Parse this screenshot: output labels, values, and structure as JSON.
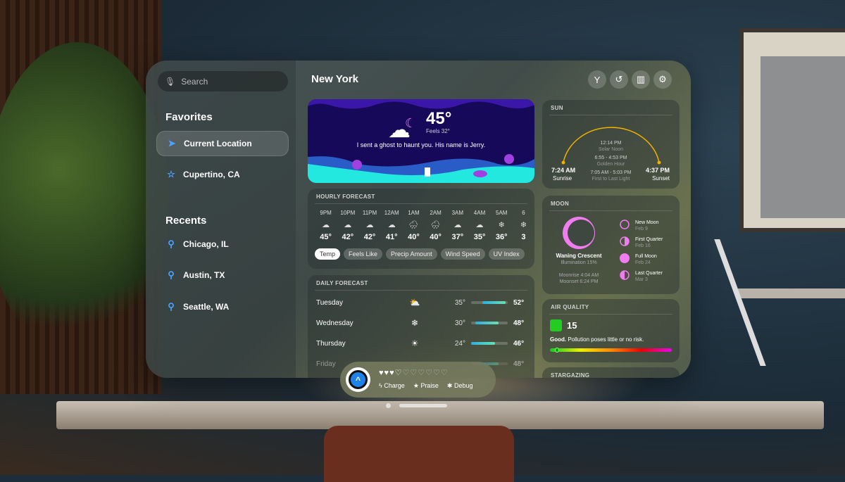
{
  "sidebar": {
    "search_placeholder": "Search",
    "favorites_heading": "Favorites",
    "favorites": [
      {
        "label": "Current Location",
        "icon": "location-arrow-icon",
        "selected": true
      },
      {
        "label": "Cupertino, CA",
        "icon": "star-icon"
      }
    ],
    "recents_heading": "Recents",
    "recents": [
      {
        "label": "Chicago, IL",
        "icon": "pin-icon"
      },
      {
        "label": "Austin, TX",
        "icon": "pin-icon"
      },
      {
        "label": "Seattle, WA",
        "icon": "pin-icon"
      }
    ]
  },
  "header": {
    "title": "New York",
    "buttons": [
      "split-icon",
      "history-icon",
      "map-icon",
      "gear-icon"
    ]
  },
  "hero": {
    "temp": "45°",
    "feels": "Feels 32°",
    "quip": "I sent a ghost to haunt you. His name is Jerry."
  },
  "hourly": {
    "heading": "HOURLY FORECAST",
    "hours": [
      {
        "t": "9PM",
        "i": "☁",
        "v": "45°"
      },
      {
        "t": "10PM",
        "i": "☁",
        "v": "42°"
      },
      {
        "t": "11PM",
        "i": "☁",
        "v": "42°"
      },
      {
        "t": "12AM",
        "i": "☁",
        "v": "41°"
      },
      {
        "t": "1AM",
        "i": "🌧",
        "v": "40°"
      },
      {
        "t": "2AM",
        "i": "🌧",
        "v": "40°"
      },
      {
        "t": "3AM",
        "i": "☁",
        "v": "37°"
      },
      {
        "t": "4AM",
        "i": "☁",
        "v": "35°"
      },
      {
        "t": "5AM",
        "i": "❄",
        "v": "36°"
      },
      {
        "t": "6",
        "i": "❄",
        "v": "3"
      }
    ],
    "tabs": [
      "Temp",
      "Feels Like",
      "Precip Amount",
      "Wind Speed",
      "UV Index"
    ],
    "active_tab": "Temp"
  },
  "daily": {
    "heading": "DAILY FORECAST",
    "days": [
      {
        "name": "Tuesday",
        "icon": "⛅",
        "lo": "35°",
        "hi": "52°",
        "range": [
          0.3,
          0.95
        ]
      },
      {
        "name": "Wednesday",
        "icon": "❄",
        "lo": "30°",
        "hi": "48°",
        "range": [
          0.12,
          0.75
        ]
      },
      {
        "name": "Thursday",
        "icon": "☀",
        "lo": "24°",
        "hi": "46°",
        "range": [
          0,
          0.65
        ]
      },
      {
        "name": "Friday",
        "icon": "·",
        "lo": "",
        "hi": "48°",
        "range": [
          0.2,
          0.75
        ]
      }
    ]
  },
  "sun": {
    "heading": "SUN",
    "sunrise": "7:24 AM",
    "sunrise_label": "Sunrise",
    "sunset": "4:37 PM",
    "sunset_label": "Sunset",
    "noon": "12:14 PM",
    "noon_label": "Solar Noon",
    "golden": "6:55 - 4:53 PM",
    "golden_label": "Golden Hour",
    "light": "7:05 AM - 5:03 PM",
    "light_label": "First to Last Light"
  },
  "moon": {
    "heading": "MOON",
    "phase": "Waning Crescent",
    "illumination": "Illumination 15%",
    "moonrise": "Moonrise 4:04 AM",
    "moonset": "Moonset 6:24 PM",
    "phases": [
      {
        "name": "New Moon",
        "date": "Feb 9"
      },
      {
        "name": "First Quarter",
        "date": "Feb 16"
      },
      {
        "name": "Full Moon",
        "date": "Feb 24"
      },
      {
        "name": "Last Quarter",
        "date": "Mar 3"
      }
    ]
  },
  "air": {
    "heading": "AIR QUALITY",
    "value": "15",
    "status": "Good.",
    "desc": "Pollution poses little or no risk.",
    "level": 0.04
  },
  "stargazing": {
    "heading": "STARGAZING"
  },
  "ornament": {
    "hearts_filled": 3.5,
    "hearts_total": 10,
    "actions": [
      {
        "label": "Charge",
        "icon": "bolt-icon"
      },
      {
        "label": "Praise",
        "icon": "star-icon"
      },
      {
        "label": "Debug",
        "icon": "bug-icon"
      }
    ]
  },
  "colors": {
    "accent": "#1e82e6",
    "moon": "#f07cf0",
    "sun_arc": "#f0b000",
    "aqi": "#22cc22"
  }
}
